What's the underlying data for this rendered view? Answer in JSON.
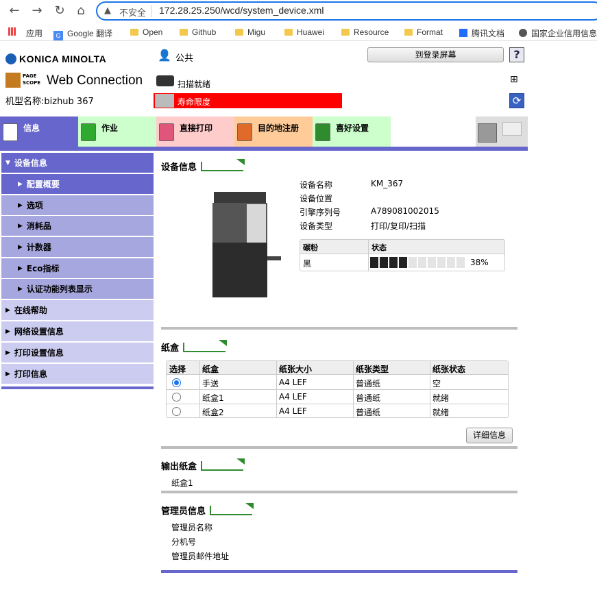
{
  "browser": {
    "insecure_label": "不安全",
    "url": "172.28.25.250/wcd/system_device.xml",
    "bookmarks": [
      "应用",
      "Google 翻译",
      "Open",
      "Github",
      "Migu",
      "Huawei",
      "Resource",
      "Format",
      "腾讯文档",
      "国家企业信用信息"
    ]
  },
  "header": {
    "brand": "KONICA MINOLTA",
    "product": "Web Connection",
    "pagescope": "PAGE SCOPE",
    "model_label": "机型名称:bizhub 367",
    "user": "公共",
    "login_button": "到登录屏幕",
    "help": "?",
    "scan_status": "扫描就绪",
    "alert": "寿命限度"
  },
  "tabs": [
    {
      "label": "信息",
      "bg": "#6666cc"
    },
    {
      "label": "作业",
      "bg": "#ccffcc"
    },
    {
      "label": "直接打印",
      "bg": "#ffcccc"
    },
    {
      "label": "目的地注册",
      "bg": "#ffcc99"
    },
    {
      "label": "喜好设置",
      "bg": "#ccffcc"
    }
  ],
  "sidebar": {
    "items": [
      {
        "label": "设备信息"
      },
      {
        "label": "配置概要"
      },
      {
        "label": "选项"
      },
      {
        "label": "消耗品"
      },
      {
        "label": "计数器"
      },
      {
        "label": "Eco指标"
      },
      {
        "label": "认证功能列表显示"
      },
      {
        "label": "在线帮助"
      },
      {
        "label": "网络设置信息"
      },
      {
        "label": "打印设置信息"
      },
      {
        "label": "打印信息"
      }
    ]
  },
  "device": {
    "title": "设备信息",
    "fields": [
      {
        "label": "设备名称",
        "value": "KM_367"
      },
      {
        "label": "设备位置",
        "value": ""
      },
      {
        "label": "引擎序列号",
        "value": "A789081002015"
      },
      {
        "label": "设备类型",
        "value": "打印/复印/扫描"
      }
    ],
    "toner_header": [
      "碳粉",
      "状态"
    ],
    "toner": {
      "color": "黑",
      "percent_label": "38%",
      "level": 0.38
    }
  },
  "tray": {
    "title": "纸盒",
    "headers": [
      "选择",
      "纸盒",
      "纸张大小",
      "纸张类型",
      "纸张状态"
    ],
    "rows": [
      {
        "name": "手送",
        "size": "A4 LEF",
        "type": "普通纸",
        "status": "空",
        "selected": true
      },
      {
        "name": "纸盒1",
        "size": "A4 LEF",
        "type": "普通纸",
        "status": "就绪",
        "selected": false
      },
      {
        "name": "纸盒2",
        "size": "A4 LEF",
        "type": "普通纸",
        "status": "就绪",
        "selected": false
      }
    ],
    "detail_button": "详细信息"
  },
  "output": {
    "title": "输出纸盒",
    "value": "纸盒1"
  },
  "admin": {
    "title": "管理员信息",
    "fields": [
      "管理员名称",
      "分机号",
      "管理员邮件地址"
    ]
  }
}
